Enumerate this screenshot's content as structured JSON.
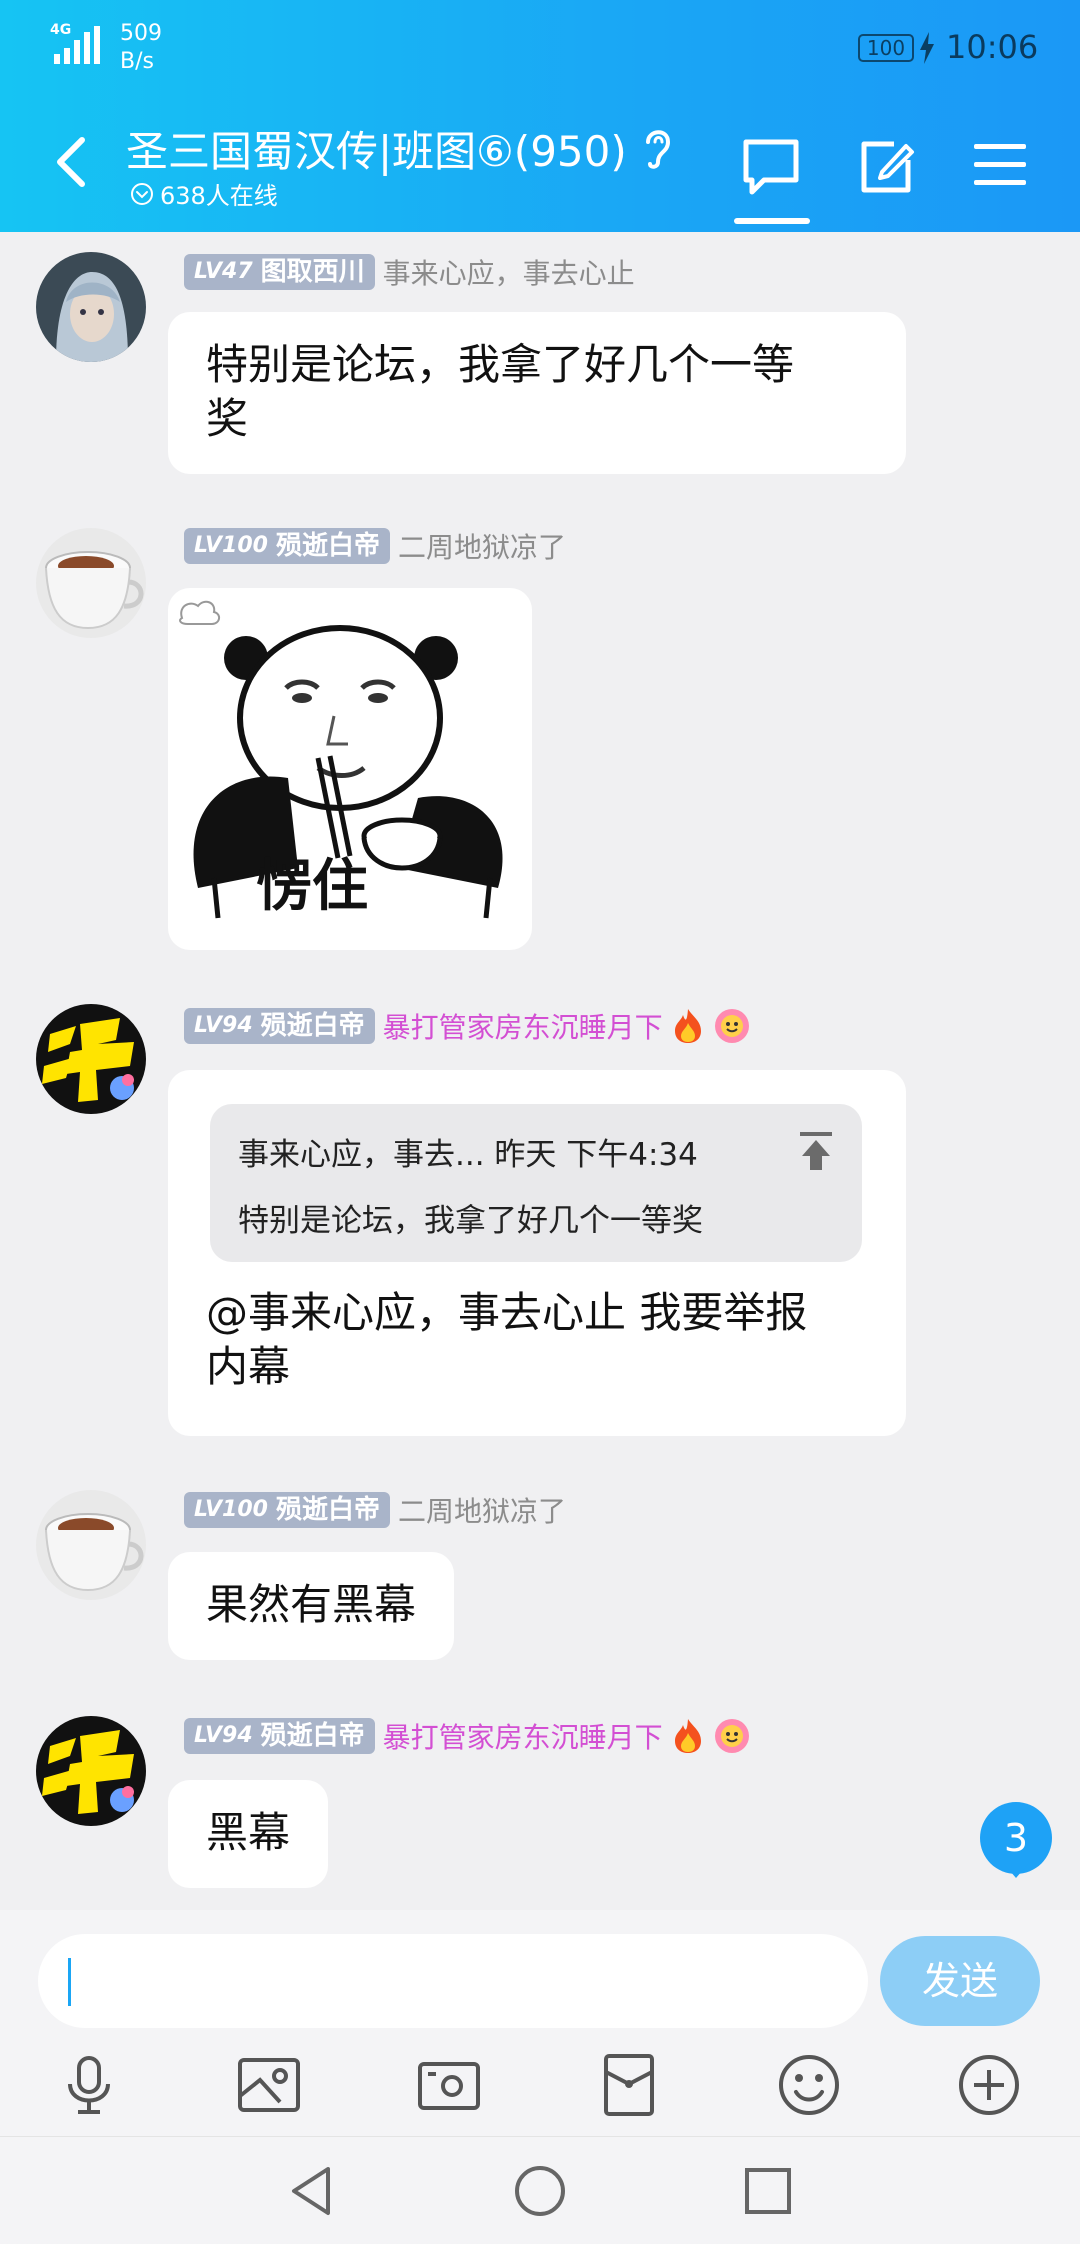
{
  "status_bar": {
    "network": "4G",
    "speed_value": "509",
    "speed_unit": "B/s",
    "battery": "100",
    "time": "10:06"
  },
  "header": {
    "title": "圣三国蜀汉传|班图⑥(950)",
    "online": "638人在线"
  },
  "messages": [
    {
      "level": "LV47",
      "name": "图取西川",
      "member_title": "事来心应，事去心止",
      "text_line1": "特别是论坛，我拿了好几个一等",
      "text_line2": "奖"
    },
    {
      "level": "LV100",
      "name": "殒逝白帝",
      "member_title": "二周地狱凉了",
      "sticker_caption": "愣住"
    },
    {
      "level": "LV94",
      "name": "殒逝白帝",
      "member_title": "暴打管家房东沉睡月下",
      "quote_header": "事来心应，事去... 昨天 下午4:34",
      "quote_body": "特别是论坛，我拿了好几个一等奖",
      "text_line1": "@事来心应，事去心止 我要举报",
      "text_line2": "内幕"
    },
    {
      "level": "LV100",
      "name": "殒逝白帝",
      "member_title": "二周地狱凉了",
      "text": "果然有黑幕"
    },
    {
      "level": "LV94",
      "name": "殒逝白帝",
      "member_title": "暴打管家房东沉睡月下",
      "text": "黑幕"
    }
  ],
  "unread_count": "3",
  "composer": {
    "placeholder": "",
    "send_label": "发送"
  },
  "colors": {
    "header_start": "#16c4f3",
    "header_end": "#1b98f6",
    "badge": "#a9b4c9",
    "pink_title": "#d34fd3",
    "send_button": "#8dcef6"
  },
  "icons": [
    "back-icon",
    "ear-icon",
    "chat-icon",
    "compose-icon",
    "menu-icon",
    "mic-icon",
    "photo-icon",
    "camera-icon",
    "red-packet-icon",
    "emoji-icon",
    "plus-icon"
  ]
}
